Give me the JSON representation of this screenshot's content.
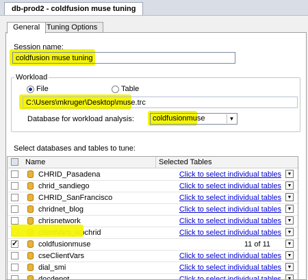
{
  "window": {
    "tab_title": "db-prod2 - coldfusion muse tuning"
  },
  "tabs": [
    {
      "label": "General"
    },
    {
      "label": "Tuning Options"
    }
  ],
  "session": {
    "label": "Session name:",
    "value": "coldfusion muse tuning"
  },
  "workload": {
    "legend": "Workload",
    "file_label": "File",
    "table_label": "Table",
    "selected": "File",
    "path": "C:\\Users\\mkruger\\Desktop\\muse.trc",
    "db_label": "Database for workload analysis:",
    "db_value": "coldfusionmuse"
  },
  "tables": {
    "label": "Select databases and tables to tune:",
    "col_name": "Name",
    "col_selected": "Selected Tables",
    "rows": [
      {
        "name": "CHRID_Pasadena",
        "selected": "Click to select individual tables",
        "checked": false
      },
      {
        "name": "chrid_sandiego",
        "selected": "Click to select individual tables",
        "checked": false
      },
      {
        "name": "CHRID_SanFrancisco",
        "selected": "Click to select individual tables",
        "checked": false
      },
      {
        "name": "chridnet_blog",
        "selected": "Click to select individual tables",
        "checked": false
      },
      {
        "name": "chrisnetwork",
        "selected": "Click to select individual tables",
        "checked": false
      },
      {
        "name": "clientVars_wpchrid",
        "selected": "Click to select individual tables",
        "checked": false
      },
      {
        "name": "coldfusionmuse",
        "selected": "11 of 11",
        "checked": true
      },
      {
        "name": "cseClientVars",
        "selected": "Click to select individual tables",
        "checked": false
      },
      {
        "name": "dial_smi",
        "selected": "Click to select individual tables",
        "checked": false
      },
      {
        "name": "docdepot",
        "selected": "Click to select individual tables",
        "checked": false
      }
    ]
  },
  "colors": {
    "highlight": "#f4f40a",
    "link": "#0000d0"
  }
}
